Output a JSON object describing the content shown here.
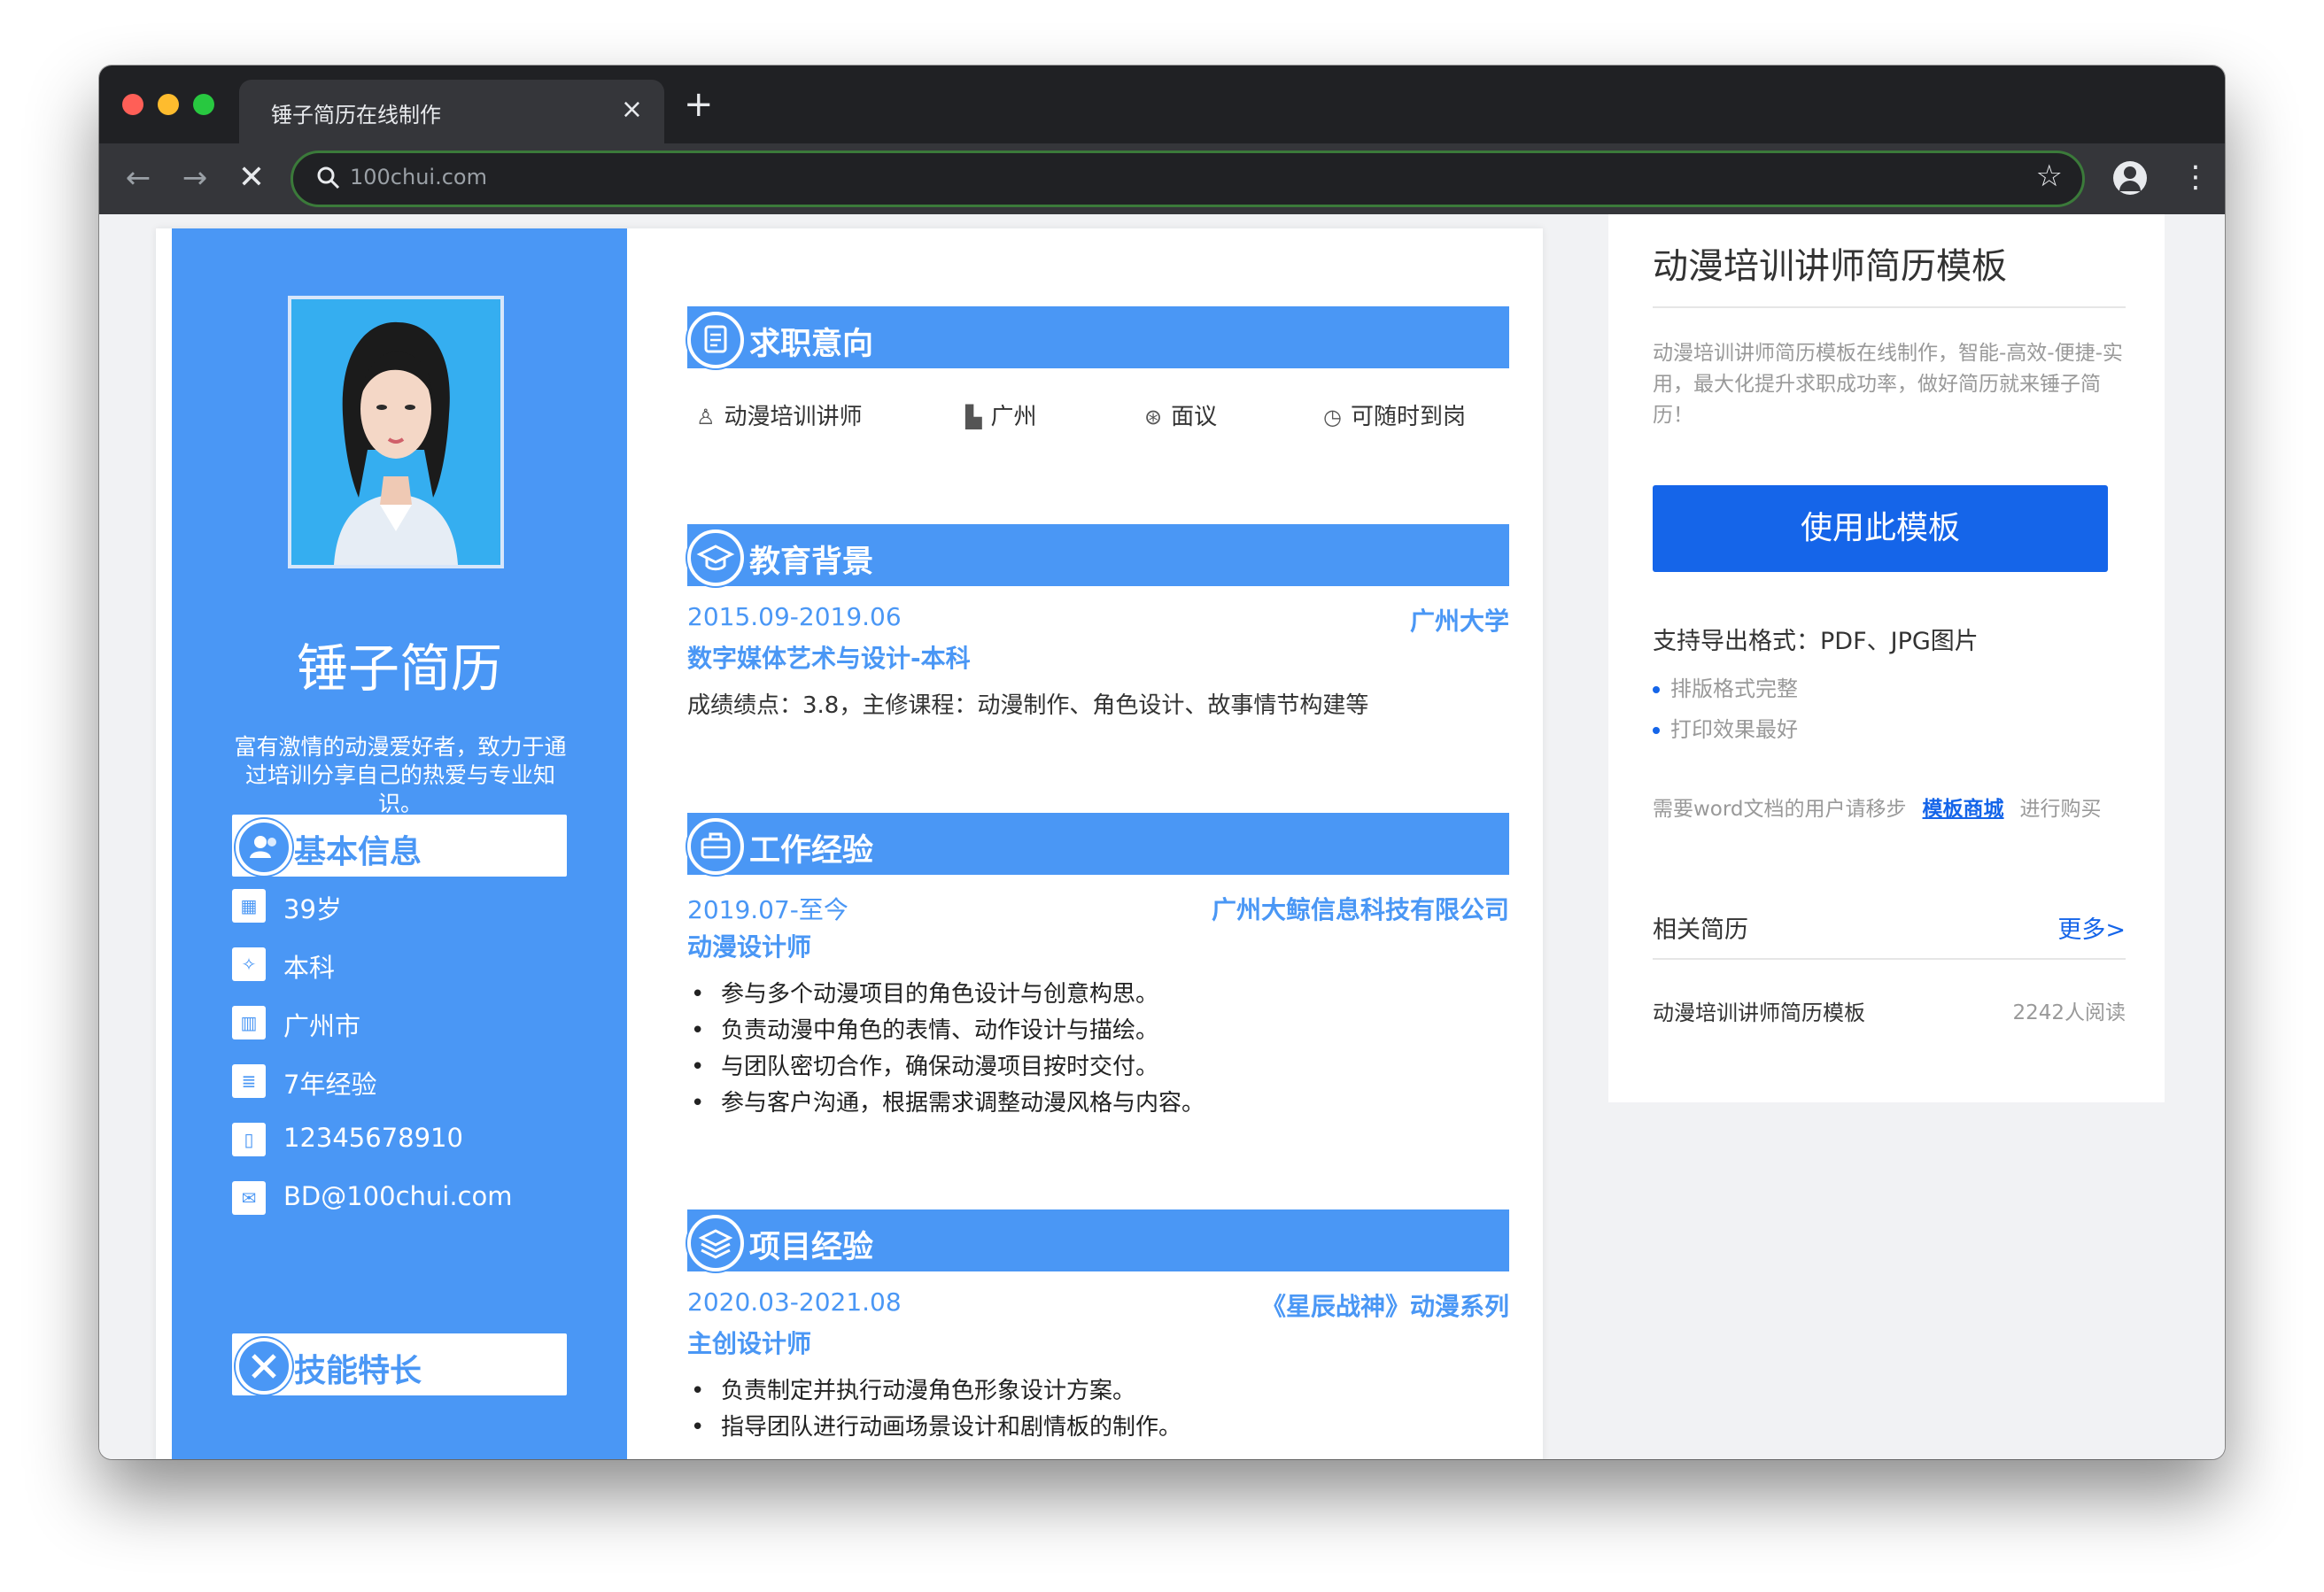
{
  "browser": {
    "tab_title": "锤子简历在线制作",
    "tab_close": "×",
    "new_tab": "+",
    "back": "←",
    "forward": "→",
    "stop": "✕",
    "url": "100chui.com",
    "star": "☆",
    "menu": "⋮"
  },
  "resume": {
    "name": "锤子简历",
    "bio": "富有激情的动漫爱好者，致力于通过培训分享自己的热爱与专业知识。",
    "basic_info_title": "基本信息",
    "basic_info": [
      {
        "icon": "calendar-icon",
        "glyph": "▦",
        "text": "39岁"
      },
      {
        "icon": "graduation-icon",
        "glyph": "✧",
        "text": "本科"
      },
      {
        "icon": "building-icon",
        "glyph": "▥",
        "text": "广州市"
      },
      {
        "icon": "document-icon",
        "glyph": "≣",
        "text": "7年经验"
      },
      {
        "icon": "phone-icon",
        "glyph": "▯",
        "text": "12345678910"
      },
      {
        "icon": "mail-icon",
        "glyph": "✉",
        "text": "BD@100chui.com"
      }
    ],
    "skills_title": "技能特长",
    "sections": {
      "intent": {
        "title": "求职意向",
        "items": [
          {
            "icon": "tie-icon",
            "glyph": "♙",
            "text": "动漫培训讲师"
          },
          {
            "icon": "city-icon",
            "glyph": "▙",
            "text": "广州"
          },
          {
            "icon": "money-icon",
            "glyph": "⊛",
            "text": "面议"
          },
          {
            "icon": "clock-icon",
            "glyph": "◷",
            "text": "可随时到岗"
          }
        ]
      },
      "education": {
        "title": "教育背景",
        "dates": "2015.09-2019.06",
        "school": "广州大学",
        "major": "数字媒体艺术与设计-本科",
        "details": "成绩绩点：3.8，主修课程：动漫制作、角色设计、故事情节构建等"
      },
      "work": {
        "title": "工作经验",
        "dates": "2019.07-至今",
        "company": "广州大鲸信息科技有限公司",
        "role": "动漫设计师",
        "bullets": [
          "参与多个动漫项目的角色设计与创意构思。",
          "负责动漫中角色的表情、动作设计与描绘。",
          "与团队密切合作，确保动漫项目按时交付。",
          "参与客户沟通，根据需求调整动漫风格与内容。"
        ]
      },
      "project": {
        "title": "项目经验",
        "dates": "2020.03-2021.08",
        "project_name": "《星辰战神》动漫系列",
        "role": "主创设计师",
        "bullets": [
          "负责制定并执行动漫角色形象设计方案。",
          "指导团队进行动画场景设计和剧情板的制作。"
        ]
      }
    }
  },
  "sidebar": {
    "title": "动漫培训讲师简历模板",
    "description": "动漫培训讲师简历模板在线制作，智能-高效-便捷-实用，最大化提升求职成功率，做好简历就来锤子简历！",
    "use_button": "使用此模板",
    "formats": "支持导出格式：PDF、JPG图片",
    "features": [
      "排版格式完整",
      "打印效果最好"
    ],
    "word_prefix": "需要word文档的用户请移步",
    "word_link": "模板商城",
    "word_suffix": "进行购买",
    "related_label": "相关简历",
    "more_label": "更多>",
    "related_items": [
      {
        "title": "动漫培训讲师简历模板",
        "views": "2242人阅读"
      }
    ]
  },
  "colors": {
    "resume_blue": "#4a97f5",
    "button_blue": "#1565e9",
    "chrome_dark": "#202124"
  }
}
